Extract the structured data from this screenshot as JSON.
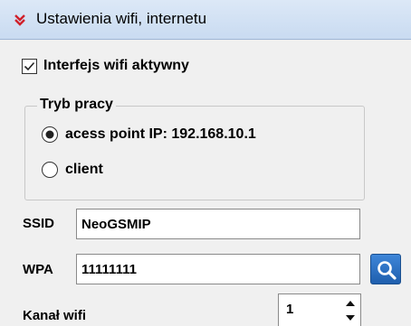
{
  "section": {
    "title": "Ustawienia wifi, internetu"
  },
  "wifi_enabled": {
    "label": "Interfejs wifi aktywny",
    "checked": true
  },
  "mode_group": {
    "legend": "Tryb pracy",
    "options": [
      {
        "label": "acess point IP: 192.168.10.1",
        "selected": true
      },
      {
        "label": "client",
        "selected": false
      }
    ]
  },
  "ssid": {
    "label": "SSID",
    "value": "NeoGSMIP"
  },
  "wpa": {
    "label": "WPA",
    "value": "11111111"
  },
  "channel": {
    "label": "Kanał wifi",
    "value": "1"
  },
  "colors": {
    "header_bg": "#c9dbf1",
    "chevron": "#d0202a",
    "search_button": "#2a6fc4"
  },
  "icons": {
    "header": "double-chevron-down-icon",
    "search": "magnifier-icon"
  }
}
